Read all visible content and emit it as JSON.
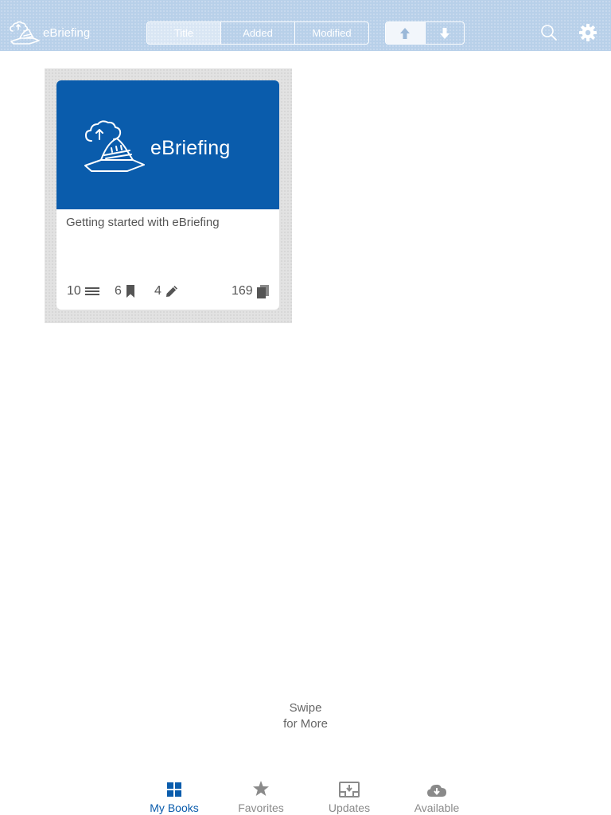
{
  "header": {
    "app_name": "eBriefing",
    "sort_tabs": [
      {
        "label": "Title",
        "active": true
      },
      {
        "label": "Added",
        "active": false
      },
      {
        "label": "Modified",
        "active": false
      }
    ],
    "order_buttons": [
      {
        "icon": "arrow-up-icon",
        "active": true
      },
      {
        "icon": "arrow-down-icon",
        "active": false
      }
    ],
    "search_icon": "search-icon",
    "settings_icon": "gear-icon"
  },
  "books": [
    {
      "cover_title": "eBriefing",
      "title": "Getting started with eBriefing",
      "chapters": "10",
      "bookmarks": "6",
      "notes": "4",
      "pages": "169"
    }
  ],
  "swipe_hint": {
    "line1": "Swipe",
    "line2": "for More"
  },
  "tabbar": {
    "tabs": [
      {
        "label": "My Books",
        "icon": "grid-icon",
        "active": true
      },
      {
        "label": "Favorites",
        "icon": "star-icon",
        "active": false
      },
      {
        "label": "Updates",
        "icon": "download-tray-icon",
        "active": false
      },
      {
        "label": "Available",
        "icon": "cloud-download-icon",
        "active": false
      }
    ]
  },
  "colors": {
    "header_bg": "#b8d0e9",
    "cover_blue": "#0a5cac",
    "active_tab": "#0a5cac",
    "inactive_tab": "#8a8a8a"
  }
}
